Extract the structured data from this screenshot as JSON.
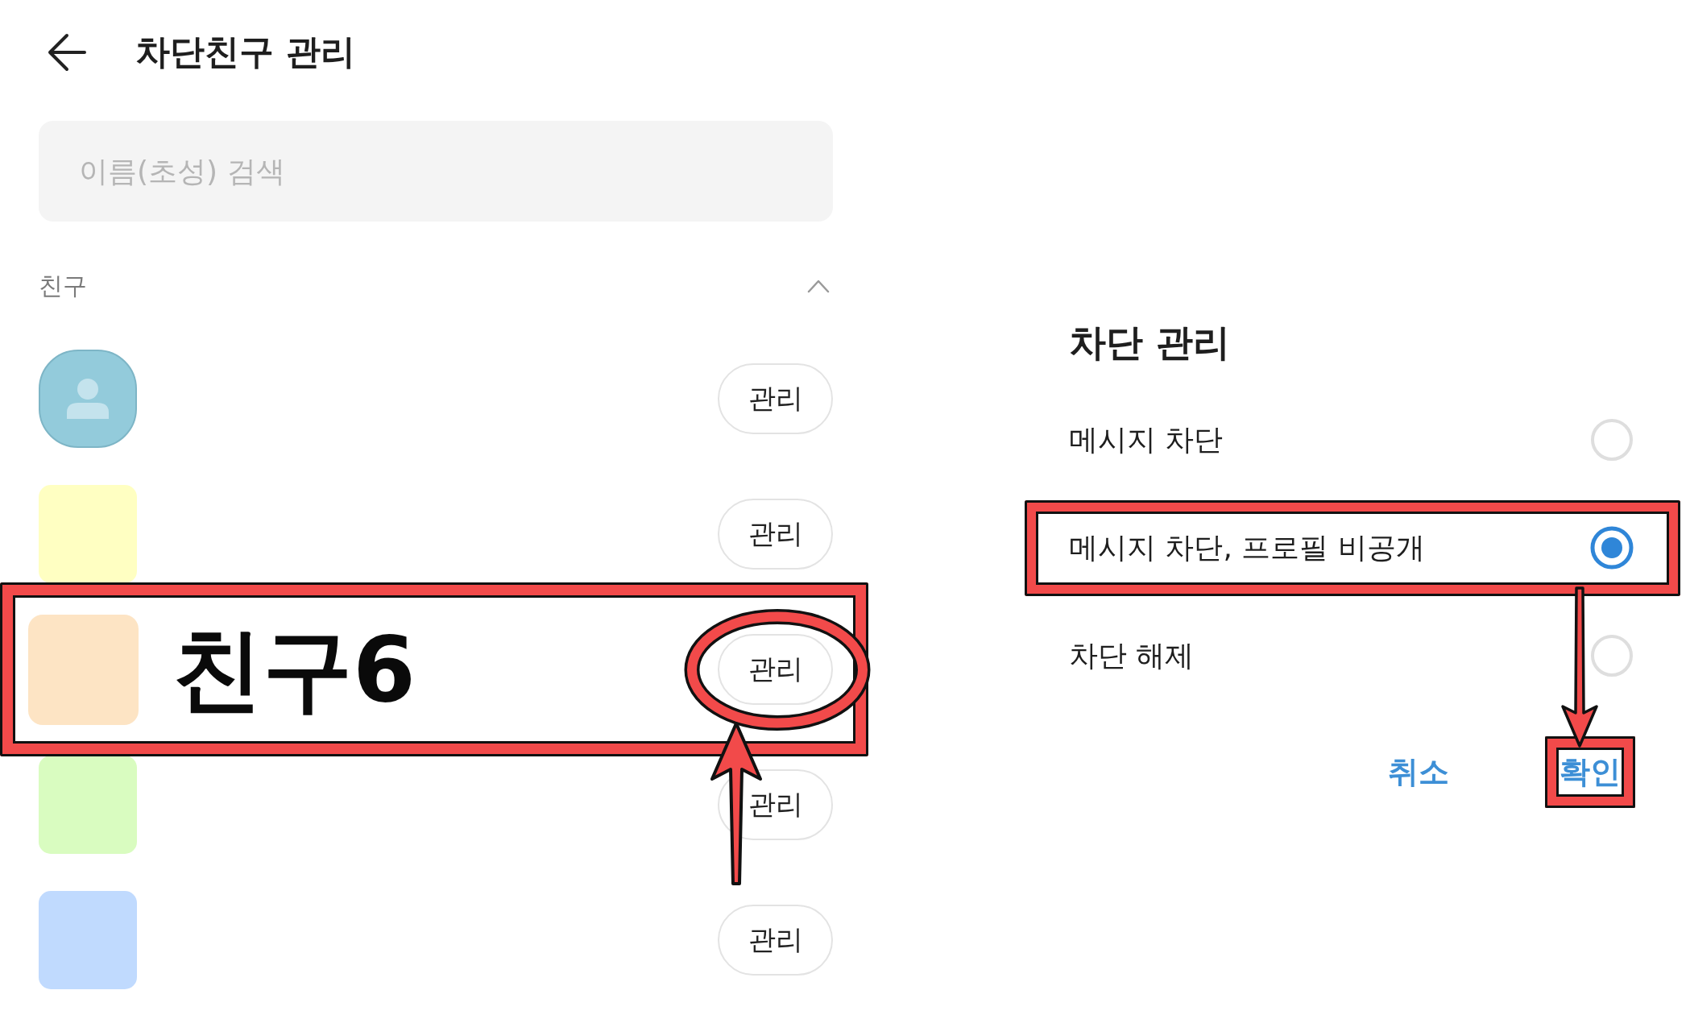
{
  "header": {
    "title": "차단친구 관리"
  },
  "search": {
    "placeholder": "이름(초성) 검색"
  },
  "section": {
    "label": "친구",
    "expanded": true
  },
  "friends": [
    {
      "kind": "silhouette",
      "color": "#93cbdb",
      "button": "관리",
      "highlighted": false,
      "button_circled": false
    },
    {
      "kind": "blank",
      "color": "#ffffc2",
      "button": "관리",
      "highlighted": false,
      "button_circled": false
    },
    {
      "kind": "blank",
      "color": "#fde4c4",
      "name": "친구6",
      "button": "관리",
      "highlighted": true,
      "button_circled": true
    },
    {
      "kind": "blank",
      "color": "#d9fcc0",
      "button": "관리",
      "highlighted": false,
      "button_circled": false
    },
    {
      "kind": "blank",
      "color": "#c0dafe",
      "button": "관리",
      "highlighted": false,
      "button_circled": false
    }
  ],
  "dialog": {
    "title": "차단 관리",
    "options": [
      {
        "label": "메시지 차단",
        "selected": false,
        "highlighted": false
      },
      {
        "label": "메시지 차단, 프로필 비공개",
        "selected": true,
        "highlighted": true
      },
      {
        "label": "차단 해제",
        "selected": false,
        "highlighted": false
      }
    ],
    "buttons": [
      {
        "label": "취소",
        "highlighted": false
      },
      {
        "label": "확인",
        "highlighted": true
      }
    ]
  }
}
